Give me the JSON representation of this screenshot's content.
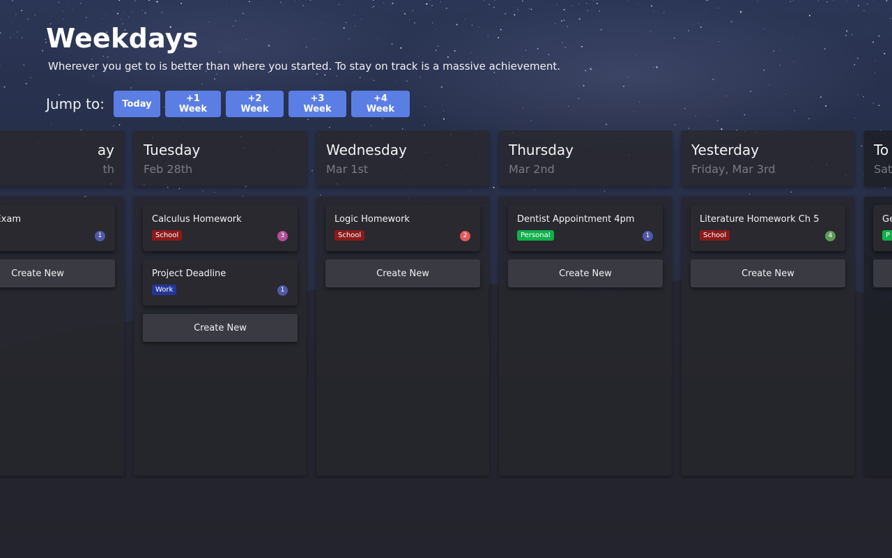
{
  "header": {
    "title": "Weekdays",
    "subtitle": "Wherever you get to is better than where you started. To stay on track is a massive achievement."
  },
  "jump": {
    "label": "Jump to:",
    "buttons": [
      "Today",
      "+1 Week",
      "+2 Week",
      "+3 Week",
      "+4 Week"
    ],
    "button_color": "#5b7ee5"
  },
  "columns": [
    {
      "title": "ay",
      "date": "th",
      "tasks": [
        {
          "title": "Exam",
          "tag": "",
          "tag_color": "#8b1a1a",
          "count": "1",
          "count_color": "#5058a8"
        }
      ],
      "create_label": "Create New"
    },
    {
      "title": "Tuesday",
      "date": "Feb 28th",
      "tasks": [
        {
          "title": "Calculus Homework",
          "tag": "School",
          "tag_color": "#8b1a1a",
          "count": "3",
          "count_color": "#b14f96"
        },
        {
          "title": "Project Deadline",
          "tag": "Work",
          "tag_color": "#23379a",
          "count": "1",
          "count_color": "#5058a8"
        }
      ],
      "create_label": "Create New"
    },
    {
      "title": "Wednesday",
      "date": "Mar 1st",
      "tasks": [
        {
          "title": "Logic Homework",
          "tag": "School",
          "tag_color": "#8b1a1a",
          "count": "2",
          "count_color": "#e05a5a"
        }
      ],
      "create_label": "Create New"
    },
    {
      "title": "Thursday",
      "date": "Mar 2nd",
      "tasks": [
        {
          "title": "Dentist Appointment 4pm",
          "tag": "Personal",
          "tag_color": "#10b14a",
          "count": "1",
          "count_color": "#5058a8"
        }
      ],
      "create_label": "Create New"
    },
    {
      "title": "Yesterday",
      "date": "Friday, Mar 3rd",
      "tasks": [
        {
          "title": "Literature Homework Ch 5",
          "tag": "School",
          "tag_color": "#8b1a1a",
          "count": "4",
          "count_color": "#5e9a5a"
        }
      ],
      "create_label": "Create New"
    },
    {
      "title": "To",
      "date": "Sat",
      "tasks": [
        {
          "title": "Ge",
          "tag": "P",
          "tag_color": "#10b14a",
          "count": "",
          "count_color": "#5058a8"
        }
      ],
      "create_label": ""
    }
  ]
}
